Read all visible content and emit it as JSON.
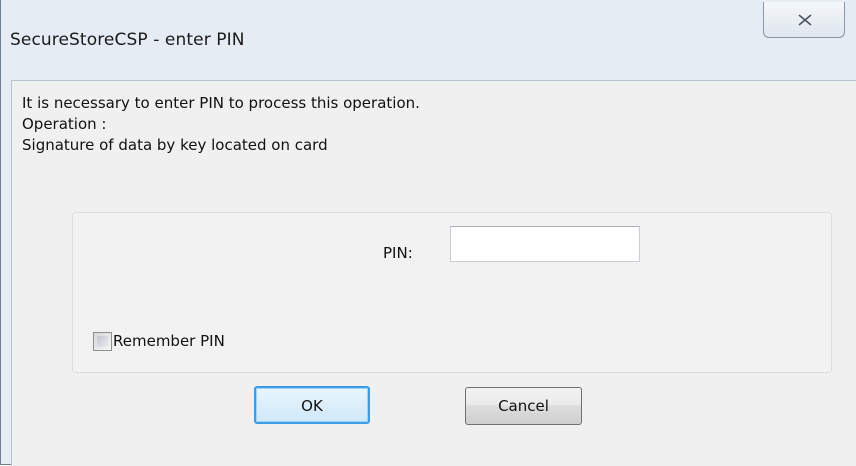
{
  "window": {
    "title": "SecureStoreCSP - enter PIN"
  },
  "message": {
    "line1": "It is necessary to enter PIN to process this operation.",
    "line2": "Operation :",
    "line3": "Signature of data by key located on card"
  },
  "form": {
    "pin_label": "PIN:",
    "pin_value": "",
    "remember_label": "Remember PIN",
    "remember_checked": false
  },
  "buttons": {
    "ok_label": "OK",
    "cancel_label": "Cancel"
  },
  "icons": {
    "close": "close-icon"
  },
  "colors": {
    "default_button_border": "#3c9ce6",
    "window_frame": "#e5ecf4",
    "client_background": "#f0f0f0"
  }
}
